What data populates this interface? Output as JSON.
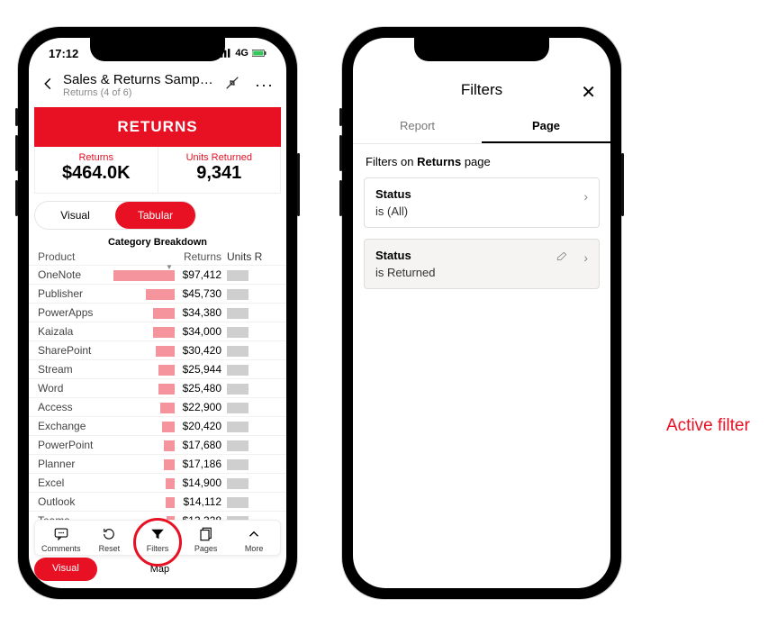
{
  "status": {
    "time": "17:12",
    "network": "4G"
  },
  "header": {
    "title": "Sales & Returns Sampl...",
    "subtitle": "Returns (4 of 6)"
  },
  "banner": "RETURNS",
  "kpis": {
    "returns": {
      "label": "Returns",
      "value": "$464.0K"
    },
    "units": {
      "label": "Units Returned",
      "value": "9,341"
    }
  },
  "viewToggle": {
    "visual": "Visual",
    "tabular": "Tabular"
  },
  "table": {
    "title": "Category Breakdown",
    "columns": {
      "product": "Product",
      "returns": "Returns",
      "units": "Units R"
    }
  },
  "chart_data": {
    "type": "bar",
    "title": "Category Breakdown",
    "xlabel": "Returns",
    "ylabel": "Product",
    "categories": [
      "OneNote",
      "Publisher",
      "PowerApps",
      "Kaizala",
      "SharePoint",
      "Stream",
      "Word",
      "Access",
      "Exchange",
      "PowerPoint",
      "Planner",
      "Excel",
      "Outlook",
      "Teams"
    ],
    "values": [
      97412,
      45730,
      34380,
      34000,
      30420,
      25944,
      25480,
      22900,
      20420,
      17680,
      17186,
      14900,
      14112,
      13328
    ],
    "value_labels": [
      "$97,412",
      "$45,730",
      "$34,380",
      "$34,000",
      "$30,420",
      "$25,944",
      "$25,480",
      "$22,900",
      "$20,420",
      "$17,680",
      "$17,186",
      "$14,900",
      "$14,112",
      "$13,328"
    ],
    "xlim": [
      0,
      100000
    ]
  },
  "toolbar": {
    "comments": "Comments",
    "reset": "Reset",
    "filters": "Filters",
    "pages": "Pages",
    "more": "More"
  },
  "bgpills": {
    "visual": "Visual",
    "map": "Map"
  },
  "filtersPanel": {
    "title": "Filters",
    "tabs": {
      "report": "Report",
      "page": "Page"
    },
    "sectionPrefix": "Filters on ",
    "sectionPage": "Returns",
    "sectionSuffix": " page",
    "card1": {
      "name": "Status",
      "value": "is (All)"
    },
    "card2": {
      "name": "Status",
      "value": "is Returned"
    }
  },
  "callout": "Active filter"
}
